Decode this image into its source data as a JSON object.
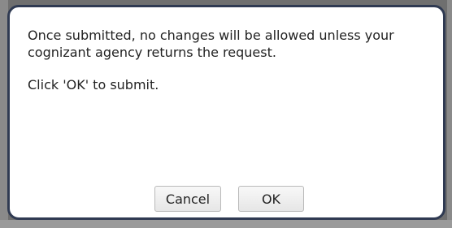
{
  "dialog": {
    "message_line1": "Once submitted, no changes will be allowed unless your cognizant agency returns the request.",
    "message_line2": "Click 'OK' to submit.",
    "buttons": {
      "cancel_label": "Cancel",
      "ok_label": "OK"
    }
  },
  "colors": {
    "dialog_border": "#2f3a52",
    "dialog_background": "#ffffff",
    "backdrop": "#6f6f6f",
    "button_border": "#b9b9b9"
  }
}
